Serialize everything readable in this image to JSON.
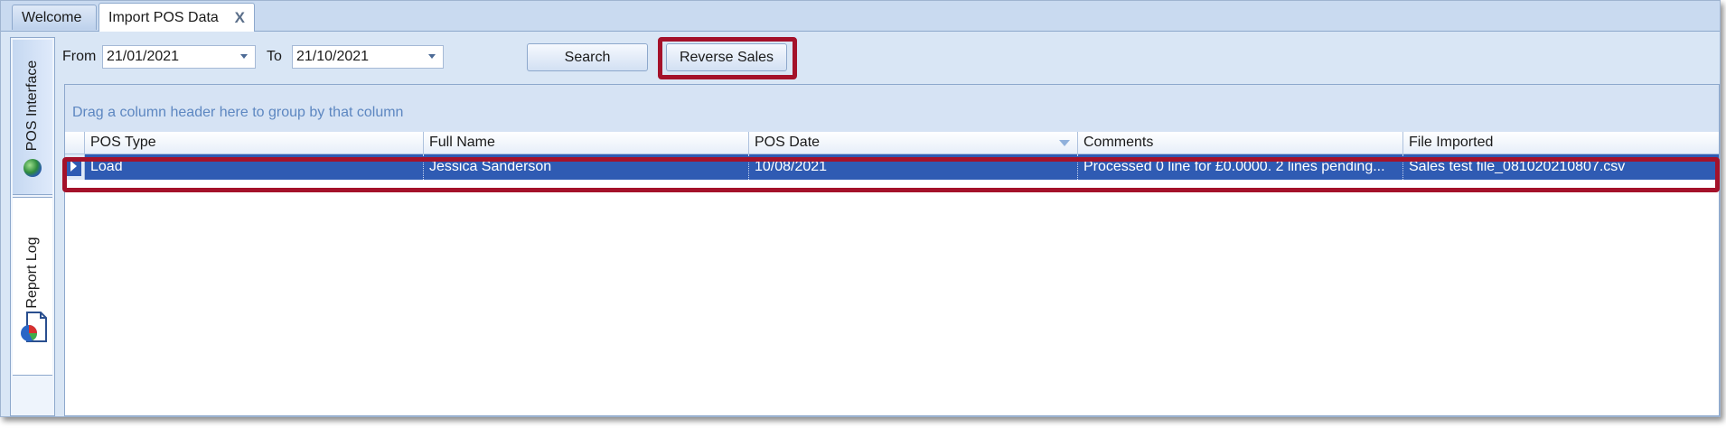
{
  "tabs": [
    {
      "label": "Welcome"
    },
    {
      "label": "Import POS Data",
      "close": "X"
    }
  ],
  "side_tabs": [
    {
      "label": "POS Interface",
      "icon": "globe-icon"
    },
    {
      "label": "Report Log",
      "icon": "report-icon"
    }
  ],
  "filters": {
    "from_label": "From",
    "from_value": "21/01/2021",
    "to_label": "To",
    "to_value": "21/10/2021",
    "search_label": "Search",
    "reverse_label": "Reverse Sales"
  },
  "grid": {
    "group_hint": "Drag a column header here to group by that column",
    "columns": [
      "POS Type",
      "Full Name",
      "POS Date",
      "Comments",
      "File Imported"
    ],
    "rows": [
      [
        "Load",
        "Jessica Sanderson",
        "10/08/2021",
        "Processed 0  line for £0.0000. 2 lines pending...",
        "Sales test file_081020210807.csv"
      ]
    ]
  },
  "colors": {
    "highlight": "#a4122a",
    "selected_row": "#2f5bb3"
  }
}
